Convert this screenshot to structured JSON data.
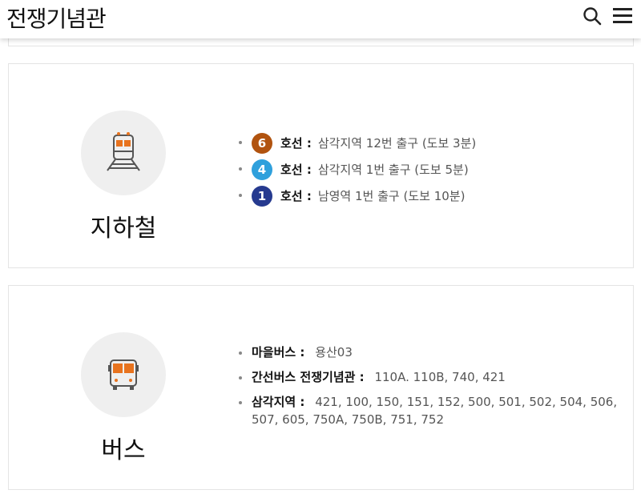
{
  "header": {
    "logo_text": "전쟁기념관",
    "search_icon": "search-icon",
    "menu_icon": "hamburger-menu-icon"
  },
  "subway": {
    "title": "지하철",
    "icon": "train-icon",
    "items": [
      {
        "line_number": "6",
        "line_color": "#b1530f",
        "label": "호선 :",
        "value": "삼각지역 12번 출구 (도보 3분)"
      },
      {
        "line_number": "4",
        "line_color": "#2fa0dc",
        "label": "호선 :",
        "value": "삼각지역 1번 출구 (도보 5분)"
      },
      {
        "line_number": "1",
        "line_color": "#263a8f",
        "label": "호선 :",
        "value": "남영역 1번 출구 (도보 10분)"
      }
    ]
  },
  "bus": {
    "title": "버스",
    "icon": "bus-icon",
    "items": [
      {
        "label": "마을버스 :",
        "value": "용산03"
      },
      {
        "label": "간선버스 전쟁기념관 :",
        "value": "110A. 110B, 740, 421"
      },
      {
        "label": "삼각지역 :",
        "value": "421, 100, 150, 151, 152, 500, 501, 502, 504, 506, 507, 605, 750A, 750B, 751, 752"
      }
    ]
  },
  "colors": {
    "icon_accent": "#e8731e",
    "icon_stroke": "#555555",
    "circle_bg": "#efefef"
  }
}
